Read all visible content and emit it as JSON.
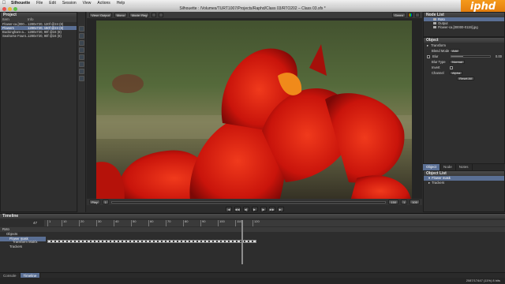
{
  "menubar": {
    "app": "Silhouette",
    "items": [
      "File",
      "Edit",
      "Session",
      "View",
      "Actions",
      "Help"
    ]
  },
  "window": {
    "title": "Silhouette : /Volumes/TURT1007/Projects/Raphd/Class 03/RTO202 – Class 03.sfx *"
  },
  "project": {
    "title": "Project",
    "columns": [
      "Item",
      "Info"
    ],
    "rows": [
      {
        "item": "Flower-ca.[000...",
        "info": "1280x720, 120f @24 (8)"
      },
      {
        "item": "Flowers",
        "info": "1280x720, 150f @24 (8)",
        "selected": true
      },
      {
        "item": "Buckingham-a...",
        "info": "1280x720, 90f @24 (8)"
      },
      {
        "item": "Seahorse Fount...",
        "info": "1280x720, 90f @24 (8)"
      }
    ]
  },
  "viewer": {
    "toolbar": {
      "view": "View: Output",
      "mode": "Mono",
      "mode2": "Mode: Reg"
    },
    "zoom_label": "Green",
    "frame_in": "1",
    "frame_out": "150",
    "frame_total": "1",
    "zoom_pct": "100",
    "transport": [
      "|◀",
      "◀◀",
      "◀|",
      "▶",
      "|▶",
      "▶▶",
      "▶|"
    ]
  },
  "nodelist": {
    "title": "Node List",
    "nodes": [
      {
        "name": "Roto",
        "selected": true
      },
      {
        "name": "Output"
      },
      {
        "name": "Flower-ca.[00000-0119].jpg"
      }
    ]
  },
  "object": {
    "title": "Object",
    "rows": [
      {
        "label": "Transform",
        "kind": "section"
      },
      {
        "label": "Blend Mode",
        "value": "Add"
      },
      {
        "label": "Blur",
        "value": "0.00"
      },
      {
        "label": "Blur Type",
        "value": "Normal"
      },
      {
        "label": "Invert",
        "value": ""
      },
      {
        "label": "Channel",
        "value": "Alpha"
      }
    ],
    "reset_label": "Reset All"
  },
  "tabs": [
    "Object",
    "Node",
    "Notes"
  ],
  "objlist": {
    "title": "Object List",
    "rows": [
      {
        "label": "Flower mask",
        "selected": true
      },
      {
        "label": "Trackers"
      }
    ]
  },
  "timeline": {
    "title": "Timeline",
    "current": "47",
    "ticks": [
      "1",
      "10",
      "20",
      "30",
      "40",
      "50",
      "60",
      "70",
      "80",
      "90",
      "100",
      "110",
      "120"
    ],
    "rows": [
      {
        "label": "Roto",
        "indent": 0
      },
      {
        "label": "Objects",
        "indent": 1
      },
      {
        "label": "Flower mask",
        "indent": 2,
        "selected": true
      },
      {
        "label": "Transform Matrix",
        "indent": 3
      },
      {
        "label": "Trackers",
        "indent": 2
      }
    ]
  },
  "bottom_tabs": [
    "Console",
    "Timeline"
  ],
  "status": "2087/17447 (11%) 8 bits",
  "logo": "iphd",
  "colors": {
    "selection": "#5a6f94",
    "accent": "#e0780a",
    "flower": "#d11a0e"
  }
}
